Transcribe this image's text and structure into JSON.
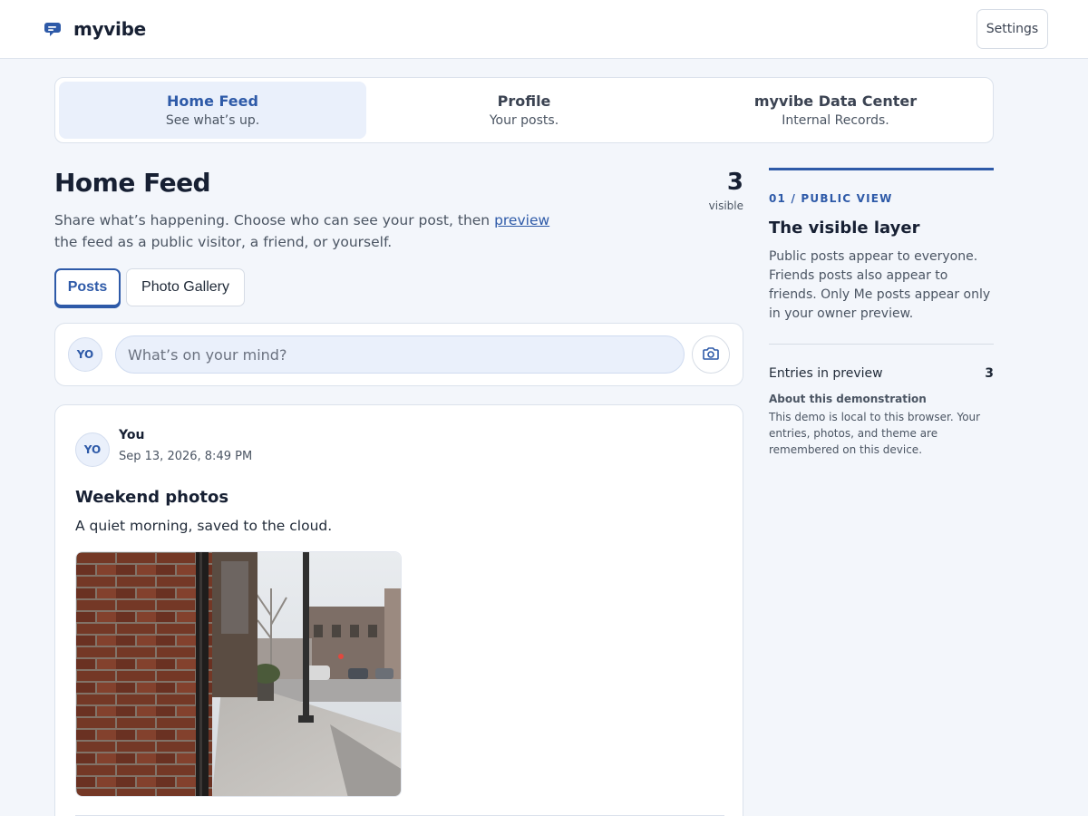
{
  "app": {
    "name": "myvibe",
    "brand_icon": "chat-bubble-icon",
    "settings_label": "Settings",
    "accent_color": "#2e5aa8"
  },
  "nav": {
    "tabs": [
      {
        "title": "Home Feed",
        "subtitle": "See what’s up.",
        "active": true
      },
      {
        "title": "Profile",
        "subtitle": "Your posts.",
        "active": false
      },
      {
        "title": "myvibe Data Center",
        "subtitle": "Internal Records.",
        "active": false
      }
    ]
  },
  "header": {
    "title": "Home Feed",
    "desc_before": "Share what’s happening. Choose who can see your post, then ",
    "desc_link": "preview",
    "desc_after": " the feed as a public visitor, a friend, or yourself.",
    "count": "3",
    "count_label": "visible"
  },
  "subtabs": [
    {
      "label": "Posts",
      "active": true
    },
    {
      "label": "Photo Gallery",
      "active": false
    }
  ],
  "composer": {
    "avatar_initials": "YO",
    "placeholder": "What’s on your mind?",
    "camera_icon": "camera-icon"
  },
  "post": {
    "avatar_initials": "YO",
    "author": "You",
    "date": "Sep 13, 2026, 8:49 PM",
    "title": "Weekend photos",
    "body": "A quiet morning, saved to the cloud."
  },
  "sidebar": {
    "kicker": "01 / PUBLIC VIEW",
    "title": "The visible layer",
    "text": "Public posts appear to everyone. Friends posts also appear to friends. Only Me posts appear only in your owner preview.",
    "entries_label": "Entries in preview",
    "entries_value": "3",
    "about_title": "About this demonstration",
    "about_text": "This demo is local to this browser. Your entries, photos, and theme are remembered on this device."
  }
}
